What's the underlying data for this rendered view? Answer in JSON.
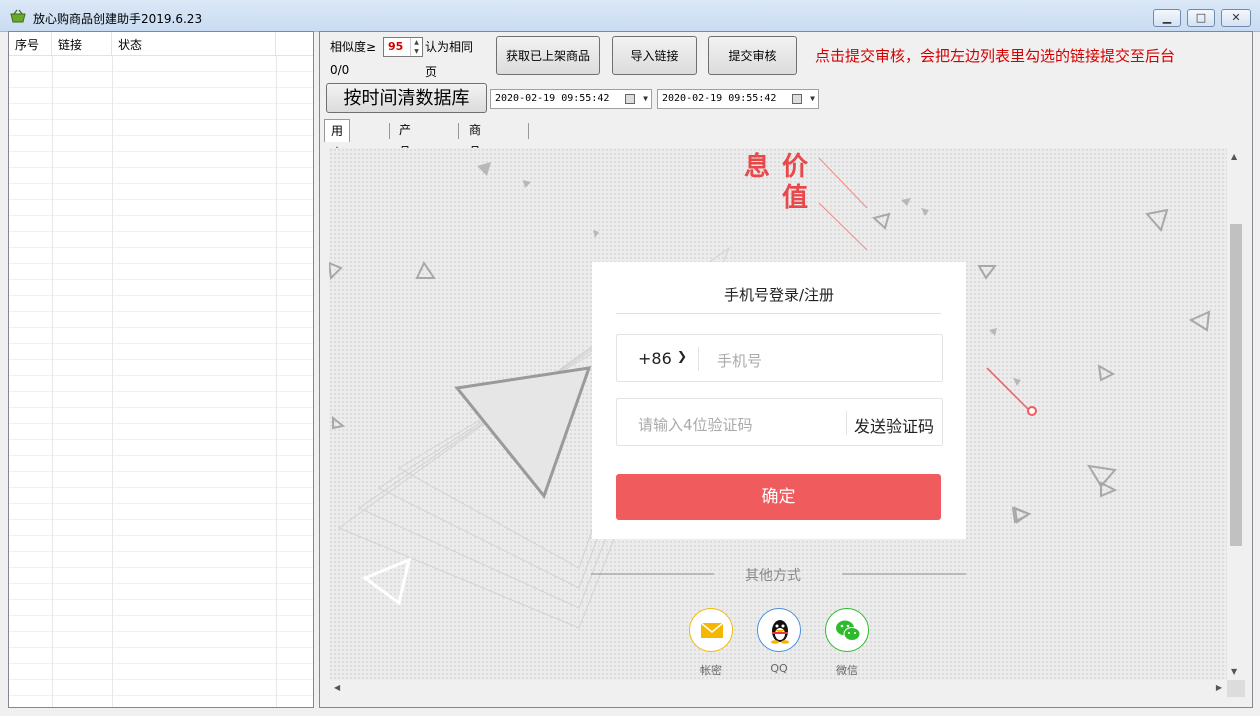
{
  "window": {
    "title": "放心购商品创建助手2019.6.23"
  },
  "list": {
    "columns": [
      "序号",
      "链接",
      "状态"
    ]
  },
  "controls": {
    "similarity_label": "相似度≥",
    "similarity_value": "95",
    "same_page_label": "认为相同",
    "same_page_label2": "页",
    "progress": "0/0",
    "btn_get": "获取已上架商品",
    "btn_import": "导入链接",
    "btn_submit": "提交审核",
    "hint": "点击提交审核，会把左边列表里勾选的链接提交至后台",
    "btn_clear": "按时间清数据库",
    "date_from": "2020-02-19 09:55:42",
    "date_to": "2020-02-19 09:55:42"
  },
  "tabs": [
    "用户登录",
    "产品参数",
    "商品主图"
  ],
  "web": {
    "brand_chars": [
      "息",
      "价",
      "值"
    ],
    "login_title": "手机号登录/注册",
    "country_code": "+86",
    "phone_placeholder": "手机号",
    "code_placeholder": "请输入4位验证码",
    "send_code": "发送验证码",
    "confirm": "确定",
    "other_methods": "其他方式",
    "social": [
      "帐密",
      "QQ",
      "微信"
    ]
  },
  "colors": {
    "accent": "#f05b5d",
    "hint": "#d40000"
  }
}
